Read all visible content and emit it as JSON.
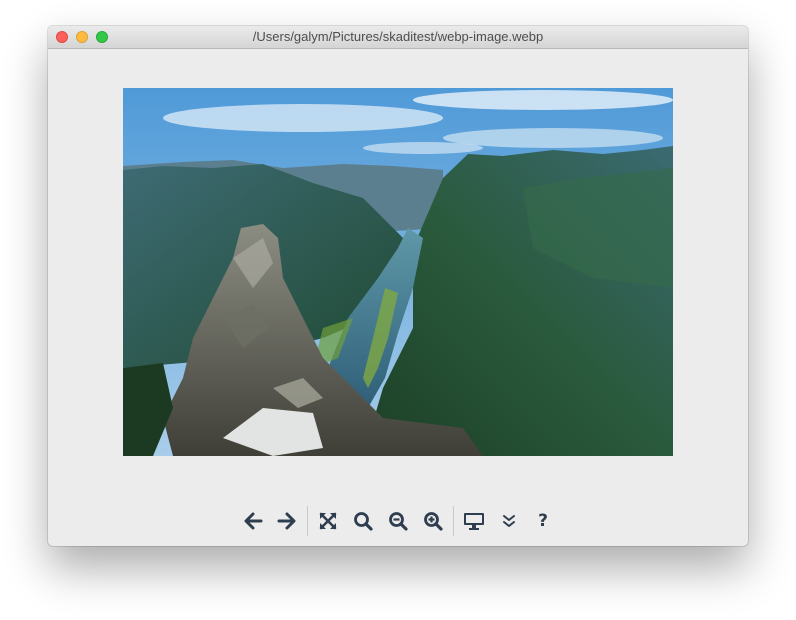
{
  "window": {
    "title": "/Users/galym/Pictures/skaditest/webp-image.webp"
  },
  "image": {
    "description_icon": "photo-icon"
  },
  "toolbar": {
    "icon_color": "#2f3e4f",
    "buttons": [
      {
        "icon": "arrow-left-icon"
      },
      {
        "icon": "arrow-right-icon"
      },
      {
        "icon": "fit-to-window-icon"
      },
      {
        "icon": "zoom-actual-icon"
      },
      {
        "icon": "zoom-out-icon"
      },
      {
        "icon": "zoom-in-icon"
      },
      {
        "icon": "slideshow-monitor-icon"
      },
      {
        "icon": "chevron-double-down-icon"
      },
      {
        "icon": "help-icon",
        "label": "?"
      }
    ]
  }
}
